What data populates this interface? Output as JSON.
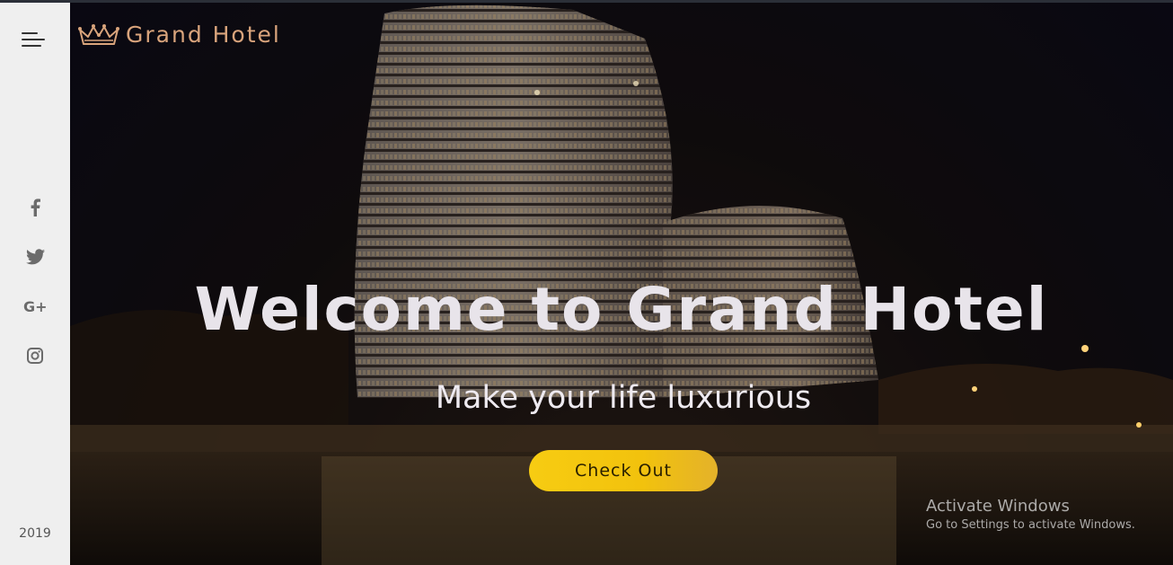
{
  "brand": {
    "name": "Grand Hotel",
    "icon": "crown-icon",
    "color": "#d9a47c"
  },
  "sidebar": {
    "menu_icon": "hamburger-menu-icon",
    "socials": [
      {
        "name": "facebook-icon"
      },
      {
        "name": "twitter-icon"
      },
      {
        "name": "google-plus-icon"
      },
      {
        "name": "instagram-icon"
      }
    ],
    "year": "2019"
  },
  "hero": {
    "title": "Welcome to Grand Hotel",
    "subtitle": "Make your life luxurious",
    "cta_label": "Check Out",
    "cta_color": "#f2c20d"
  },
  "overlay": {
    "activate_title": "Activate Windows",
    "activate_text": "Go to Settings to activate Windows."
  }
}
